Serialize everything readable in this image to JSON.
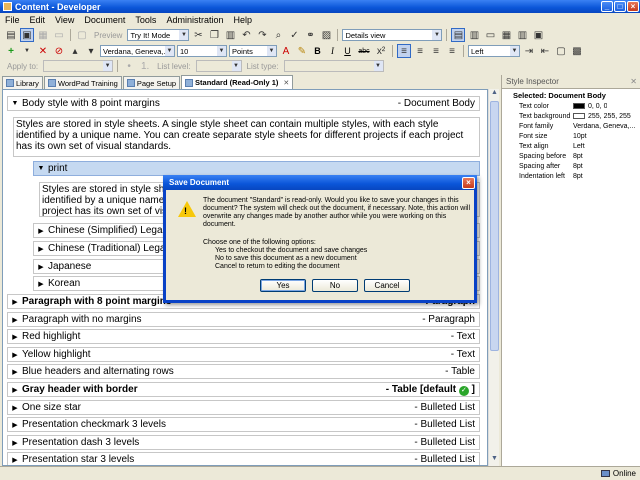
{
  "window": {
    "title": "Content - Developer"
  },
  "menu": [
    "File",
    "Edit",
    "View",
    "Document",
    "Tools",
    "Administration",
    "Help"
  ],
  "toolbar1": {
    "preview_label": "Preview",
    "mode_value": "Try It! Mode",
    "view_value": "Details view"
  },
  "toolbar2": {
    "font_value": "Verdana, Geneva,...",
    "size_value": "10",
    "unit_value": "Points",
    "align_value": "Left",
    "bold": "B",
    "italic": "I",
    "underline": "U",
    "abc": "abc"
  },
  "toolbar3": {
    "apply_to_label": "Apply to:",
    "list_level_label": "List level:",
    "list_type_label": "List type:"
  },
  "tabs": [
    {
      "label": "Library"
    },
    {
      "label": "WordPad Training"
    },
    {
      "label": "Page Setup"
    },
    {
      "label": "Standard (Read-Only 1)"
    }
  ],
  "editor": {
    "body": {
      "name": "Body style with 8 point margins",
      "type": "- Document Body"
    },
    "body_text": "Styles are stored in style sheets. A single style sheet can contain multiple styles, with each style identified by a unique name. You can create separate style sheets for different projects if each project has its own set of visual standards.",
    "print": {
      "name": "print"
    },
    "print_text": "Styles are stored in style sheets. A single style sheet can contain multiple styles, with each style identified by a unique name. You can create separate style sheets for different projects if each project has its own set of visual standards.",
    "sub_items": [
      "Chinese (Simplified) Legal",
      "Chinese (Traditional) Legal",
      "Japanese",
      "Korean"
    ],
    "styles": [
      {
        "name": "Paragraph with 8 point margins",
        "type": "- Paragraph",
        "bold": true
      },
      {
        "name": "Paragraph with no margins",
        "type": "- Paragraph",
        "bold": false
      },
      {
        "name": "Red highlight",
        "type": "- Text",
        "bold": false
      },
      {
        "name": "Yellow highlight",
        "type": "- Text",
        "bold": false
      },
      {
        "name": "Blue headers and alternating rows",
        "type": "- Table",
        "bold": false
      },
      {
        "name": "Gray header with border",
        "type": "- Table [default",
        "bold": true
      },
      {
        "name": "One size star",
        "type": "- Bulleted List",
        "bold": false
      },
      {
        "name": "Presentation checkmark 3 levels",
        "type": "- Bulleted List",
        "bold": false
      },
      {
        "name": "Presentation dash 3 levels",
        "type": "- Bulleted List",
        "bold": false
      },
      {
        "name": "Presentation star 3 levels",
        "type": "- Bulleted List",
        "bold": false
      }
    ],
    "default_close": "]"
  },
  "dialog": {
    "title": "Save Document",
    "message": "The document \"Standard\" is read-only. Would you like to save your changes in this document? The system will check out the document, if necessary. Note, this action will overwrite any changes made by another author while you were working on this document.",
    "options_intro": "Choose one of the following options:",
    "options": [
      "Yes to checkout the document and save changes",
      "No to save this document as a new document",
      "Cancel to return to editing the document"
    ],
    "yes": "Yes",
    "no": "No",
    "cancel": "Cancel"
  },
  "inspector": {
    "title": "Style Inspector",
    "selected": "Selected: Document Body",
    "props": [
      {
        "key": "Text color",
        "value": "0, 0, 0",
        "swatch": "#000000"
      },
      {
        "key": "Text background",
        "value": "255, 255, 255",
        "swatch": "#ffffff"
      },
      {
        "key": "Font family",
        "value": "Verdana, Geneva,..."
      },
      {
        "key": "Font size",
        "value": "10pt"
      },
      {
        "key": "Text align",
        "value": "Left"
      },
      {
        "key": "Spacing before",
        "value": "8pt"
      },
      {
        "key": "Spacing after",
        "value": "8pt"
      },
      {
        "key": "Indentation left",
        "value": "8pt"
      }
    ]
  },
  "status": {
    "connection": "Online"
  }
}
